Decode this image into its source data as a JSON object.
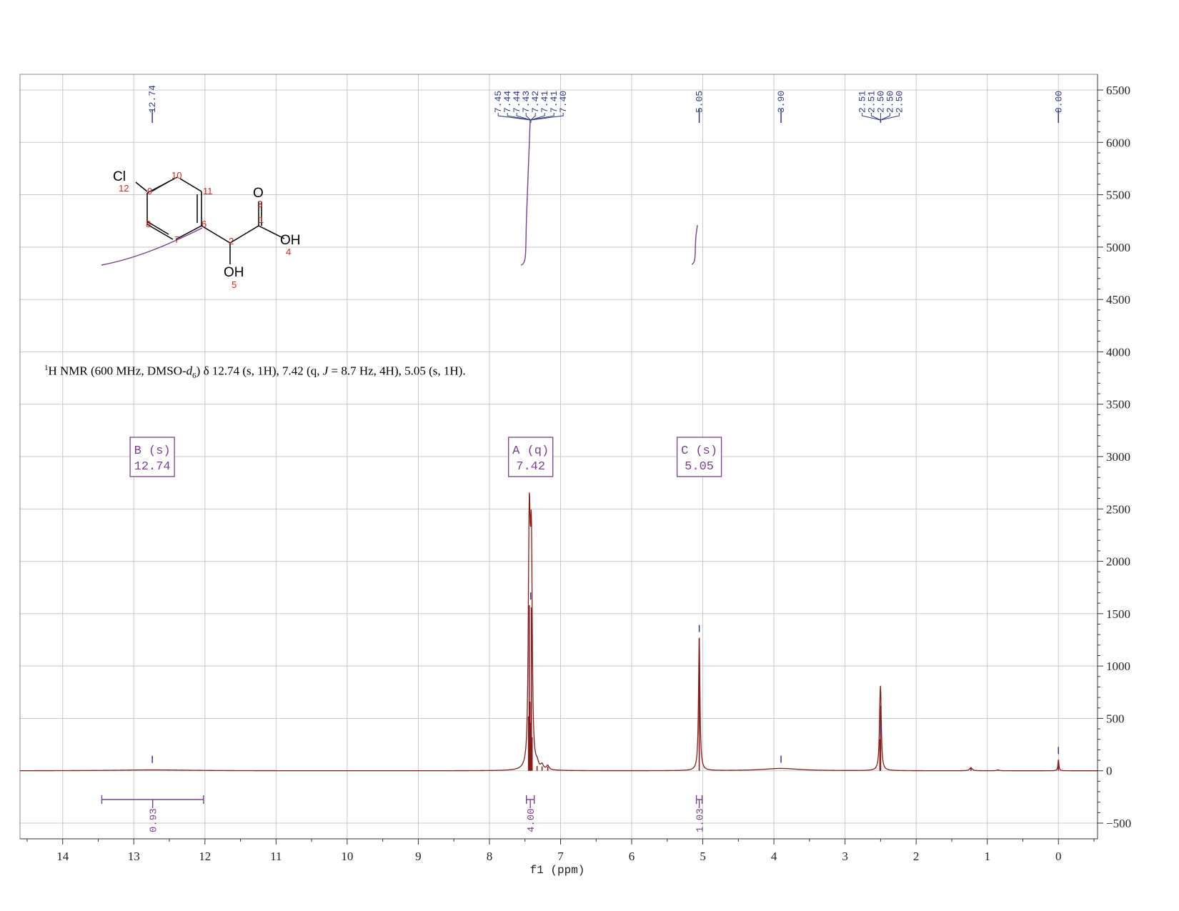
{
  "chart_data": {
    "type": "line",
    "xlabel": "f1 (ppm)",
    "x_reversed": true,
    "xlim": [
      14.6,
      -0.55
    ],
    "ylim": [
      -650,
      6650
    ],
    "x_ticks": [
      "14",
      "13",
      "12",
      "11",
      "10",
      "9",
      "8",
      "7",
      "6",
      "5",
      "4",
      "3",
      "2",
      "1",
      "0"
    ],
    "y_ticks": [
      "6500",
      "6000",
      "5500",
      "5000",
      "4500",
      "4000",
      "3500",
      "3000",
      "2500",
      "2000",
      "1500",
      "1000",
      "500",
      "0",
      "-500"
    ],
    "grid": true,
    "colors": {
      "spectrum": "#8b1a1a",
      "peak_labels": "#2e3a8c",
      "integral": "#7b3f8f",
      "multiplet": "#7b3f8f",
      "grid": "#c8c8c8",
      "atom_numbers": "#e0201c"
    },
    "series": [
      {
        "peaks": [
          {
            "ppm": 12.74,
            "height": 8,
            "width": 0.6
          },
          {
            "ppm": 7.45,
            "height": 520,
            "width": 0.012
          },
          {
            "ppm": 7.44,
            "height": 1580,
            "width": 0.012
          },
          {
            "ppm": 7.43,
            "height": 660,
            "width": 0.012
          },
          {
            "ppm": 7.42,
            "height": 460,
            "width": 0.012
          },
          {
            "ppm": 7.41,
            "height": 1560,
            "width": 0.012
          },
          {
            "ppm": 7.4,
            "height": 320,
            "width": 0.012
          },
          {
            "ppm": 7.33,
            "height": 45,
            "width": 0.02
          },
          {
            "ppm": 7.26,
            "height": 42,
            "width": 0.02
          },
          {
            "ppm": 7.18,
            "height": 40,
            "width": 0.02
          },
          {
            "ppm": 5.05,
            "height": 1270,
            "width": 0.012
          },
          {
            "ppm": 3.9,
            "height": 22,
            "width": 0.3
          },
          {
            "ppm": 2.51,
            "height": 300,
            "width": 0.012
          },
          {
            "ppm": 2.5,
            "height": 620,
            "width": 0.012
          },
          {
            "ppm": 1.23,
            "height": 30,
            "width": 0.02
          },
          {
            "ppm": 0.85,
            "height": 8,
            "width": 0.02
          },
          {
            "ppm": 0.0,
            "height": 105,
            "width": 0.008
          }
        ]
      }
    ],
    "peak_label_groups": [
      {
        "labels": [
          "12.74"
        ],
        "ppm": 12.74
      },
      {
        "labels": [
          "7.45",
          "7.44",
          "7.44",
          "7.43",
          "7.42",
          "7.41",
          "7.41",
          "7.40"
        ],
        "ppm": 7.42
      },
      {
        "labels": [
          "5.05"
        ],
        "ppm": 5.05
      },
      {
        "labels": [
          "3.90"
        ],
        "ppm": 3.9
      },
      {
        "labels": [
          "2.51",
          "2.51",
          "2.50",
          "2.50",
          "2.50"
        ],
        "ppm": 2.5
      },
      {
        "labels": [
          "0.00"
        ],
        "ppm": 0.0
      }
    ],
    "multiplets": [
      {
        "name": "B (s)",
        "shift": "12.74",
        "ppm": 12.74
      },
      {
        "name": "A (q)",
        "shift": "7.42",
        "ppm": 7.42
      },
      {
        "name": "C (s)",
        "shift": "5.05",
        "ppm": 5.05
      }
    ],
    "integrals": [
      {
        "value": "0.93",
        "from": 13.45,
        "to": 12.02
      },
      {
        "value": "4.00",
        "from": 7.48,
        "to": 7.37
      },
      {
        "value": "1.03",
        "from": 5.09,
        "to": 5.01
      }
    ]
  },
  "summary": {
    "prefix": "H NMR (600 MHz, DMSO-",
    "prefix_sup": "1",
    "solvent_italic": "d",
    "solvent_sub": "6",
    "middle": ") δ 12.74 (s, 1H), 7.42 (q, ",
    "j_italic": "J",
    "suffix": " = 8.7 Hz, 4H), 5.05 (s, 1H)."
  },
  "structure": {
    "labels": {
      "cl": "Cl",
      "o": "O",
      "oh_acid": "OH",
      "oh_alcohol": "OH"
    },
    "atom_numbers": [
      "1",
      "2",
      "3",
      "4",
      "5",
      "6",
      "7",
      "8",
      "9",
      "10",
      "11",
      "12"
    ]
  }
}
